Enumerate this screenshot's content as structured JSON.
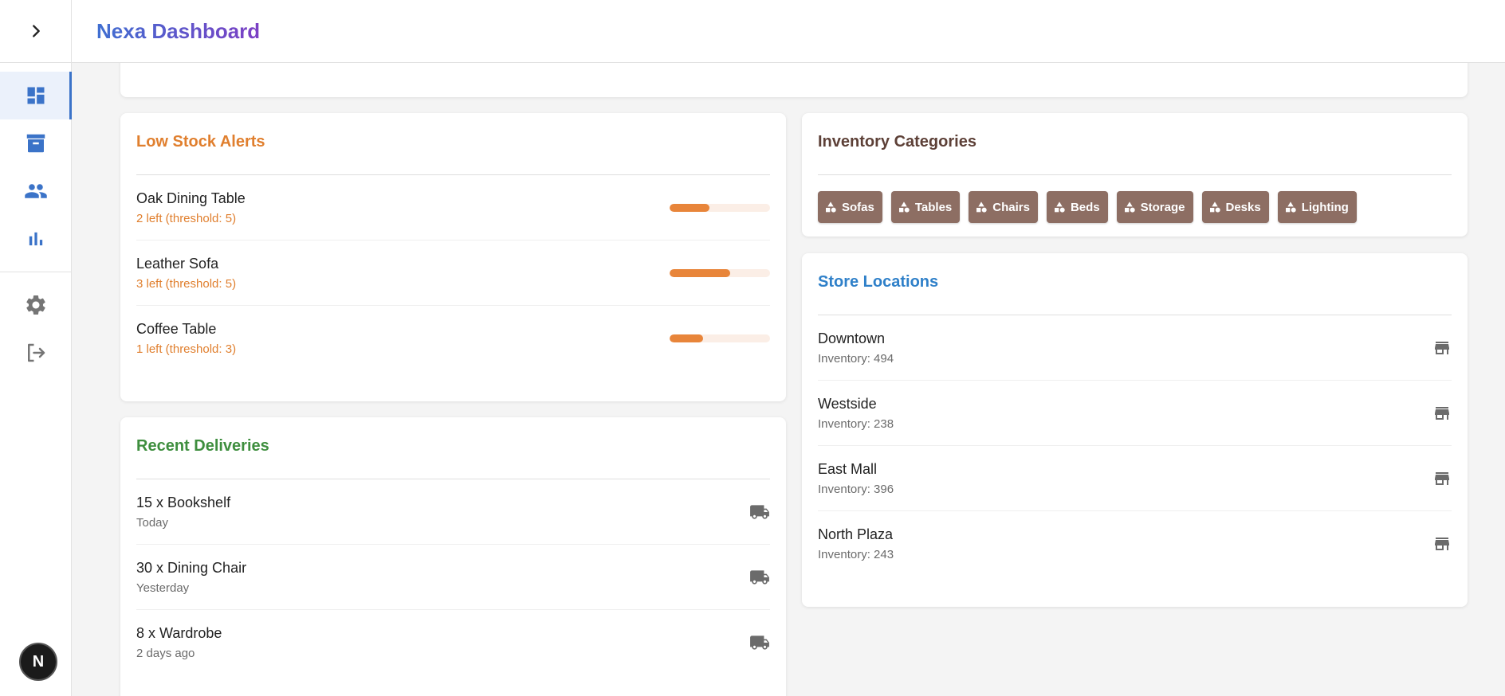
{
  "header": {
    "title": "Nexa Dashboard"
  },
  "sidebar": {
    "items": [
      {
        "icon": "dashboard-icon",
        "active": true
      },
      {
        "icon": "archive-icon",
        "active": false
      },
      {
        "icon": "people-icon",
        "active": false
      },
      {
        "icon": "bar-chart-icon",
        "active": false
      },
      {
        "icon": "gear-icon",
        "active": false
      },
      {
        "icon": "logout-icon",
        "active": false
      }
    ],
    "avatar_letter": "N"
  },
  "low_stock": {
    "title": "Low Stock Alerts",
    "items": [
      {
        "name": "Oak Dining Table",
        "status": "2 left (threshold: 5)",
        "level": 0.4
      },
      {
        "name": "Leather Sofa",
        "status": "3 left (threshold: 5)",
        "level": 0.6
      },
      {
        "name": "Coffee Table",
        "status": "1 left (threshold: 3)",
        "level": 0.33
      }
    ]
  },
  "deliveries": {
    "title": "Recent Deliveries",
    "items": [
      {
        "name": "15 x Bookshelf",
        "when": "Today"
      },
      {
        "name": "30 x Dining Chair",
        "when": "Yesterday"
      },
      {
        "name": "8 x Wardrobe",
        "when": "2 days ago"
      }
    ]
  },
  "categories": {
    "title": "Inventory Categories",
    "items": [
      "Sofas",
      "Tables",
      "Chairs",
      "Beds",
      "Storage",
      "Desks",
      "Lighting"
    ]
  },
  "stores": {
    "title": "Store Locations",
    "items": [
      {
        "name": "Downtown",
        "inventory": "Inventory: 494"
      },
      {
        "name": "Westside",
        "inventory": "Inventory: 238"
      },
      {
        "name": "East Mall",
        "inventory": "Inventory: 396"
      },
      {
        "name": "North Plaza",
        "inventory": "Inventory: 243"
      }
    ]
  },
  "colors": {
    "accent_blue": "#3b73c8",
    "low_stock_orange": "#e07f2e",
    "deliveries_green": "#3e8e3e",
    "categories_brown": "#5d4037",
    "stores_blue": "#2f80c9",
    "chip_brown": "#8d6e63"
  }
}
